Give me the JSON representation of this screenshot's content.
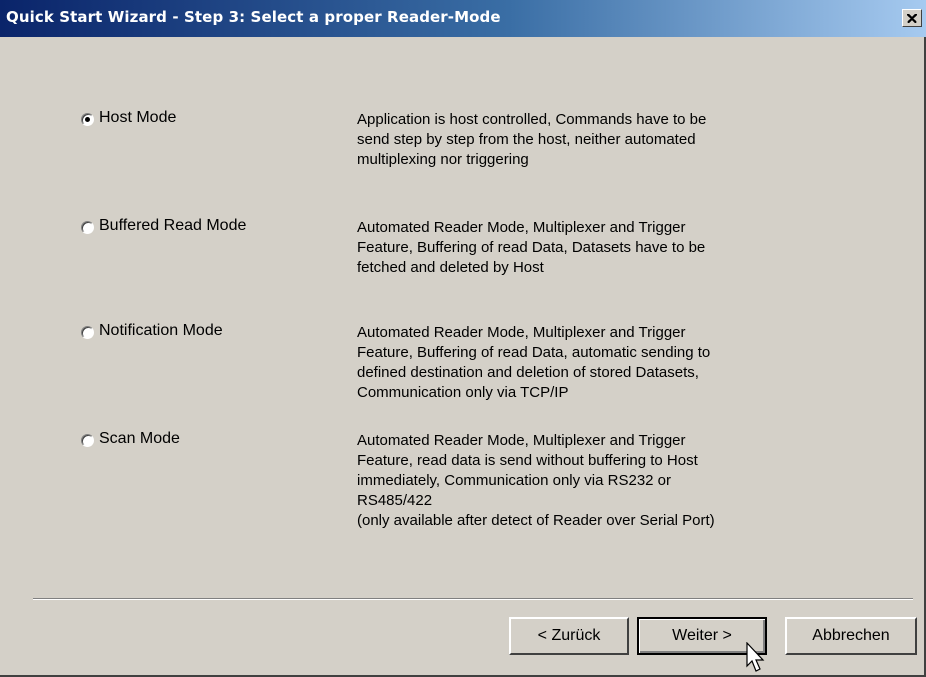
{
  "window": {
    "title": "Quick Start Wizard - Step 3: Select a proper Reader-Mode",
    "close_label": "×"
  },
  "modes": [
    {
      "label": "Host Mode",
      "selected": true,
      "description_lines": [
        "Application is host controlled, Commands have to be",
        "send step by step from the host, neither automated",
        "multiplexing nor triggering"
      ]
    },
    {
      "label": "Buffered Read Mode",
      "selected": false,
      "description_lines": [
        "Automated Reader Mode, Multiplexer and Trigger",
        "Feature, Buffering of read Data, Datasets have to be",
        "fetched and deleted by Host"
      ]
    },
    {
      "label": "Notification Mode",
      "selected": false,
      "description_lines": [
        "Automated Reader Mode, Multiplexer and Trigger",
        "Feature, Buffering of read Data, automatic sending to",
        "defined destination and deletion of stored Datasets,",
        "Communication only via TCP/IP"
      ]
    },
    {
      "label": "Scan Mode",
      "selected": false,
      "description_lines": [
        "Automated Reader Mode, Multiplexer and Trigger",
        "Feature, read data is send without buffering to Host",
        "immediately, Communication only via RS232 or",
        "RS485/422",
        "(only available after detect of Reader over Serial Port)"
      ]
    }
  ],
  "buttons": {
    "back_label": "< Zurück",
    "next_label": "Weiter >",
    "cancel_label": "Abbrechen"
  },
  "colors": {
    "face": "#d4d0c8",
    "title_start": "#0a246a",
    "title_end": "#a6caf0"
  }
}
